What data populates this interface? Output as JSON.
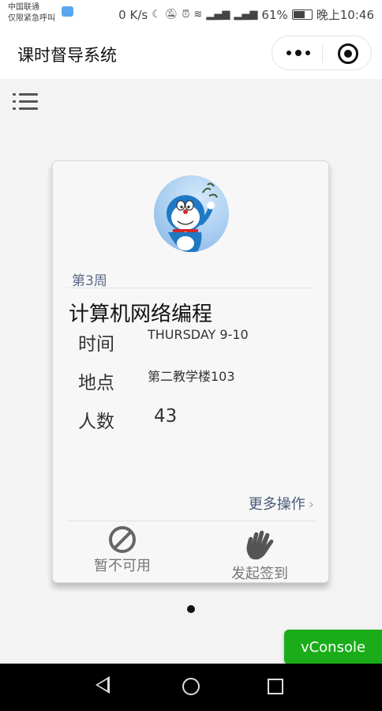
{
  "status_bar": {
    "carrier_line1": "中国联通",
    "carrier_line2": "仅限紧急呼叫",
    "net_speed": "0 K/s",
    "battery": "61%",
    "time": "晚上10:46"
  },
  "navbar": {
    "title": "课时督导系统"
  },
  "card": {
    "week": "第3周",
    "course_name": "计算机网络编程",
    "time_label": "时间",
    "time_value": "THURSDAY 9-10",
    "location_label": "地点",
    "location_value": "第二教学楼103",
    "count_label": "人数",
    "count_value": "43",
    "more_actions": "更多操作",
    "more_chevron": "›",
    "action_unavailable": "暂不可用",
    "action_start_signin": "发起签到"
  },
  "vconsole_label": "vConsole",
  "colors": {
    "accent_green": "#1aad19",
    "week_text": "#5a6a85",
    "page_bg": "#f3f3f3"
  },
  "icons": {
    "menu": "list-icon",
    "unavailable": "ban-icon",
    "signin": "hand-icon"
  }
}
